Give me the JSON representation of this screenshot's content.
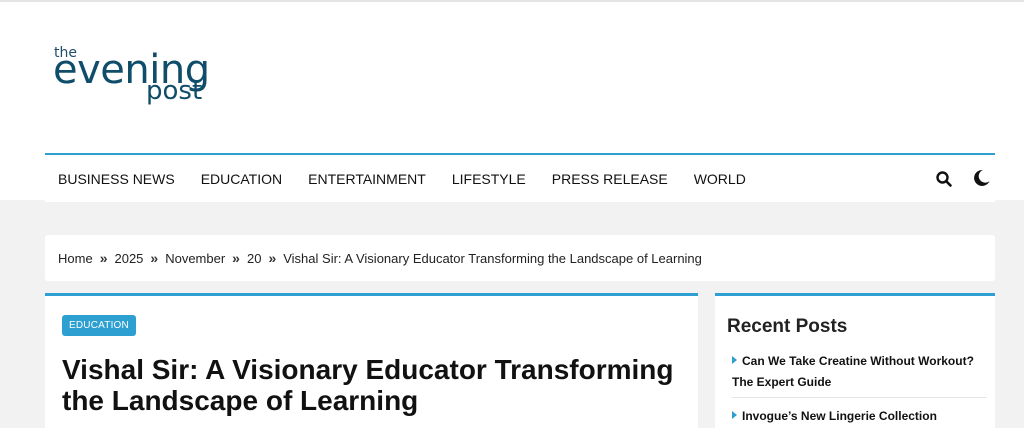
{
  "logo": {
    "the": "the",
    "evening": "evening",
    "post": "post"
  },
  "nav": {
    "items": [
      "BUSINESS NEWS",
      "EDUCATION",
      "ENTERTAINMENT",
      "LIFESTYLE",
      "PRESS RELEASE",
      "WORLD"
    ],
    "icons": [
      "search-icon",
      "moon-icon"
    ]
  },
  "breadcrumb": [
    "Home",
    "2025",
    "November",
    "20",
    "Vishal Sir: A Visionary Educator Transforming the Landscape of Learning"
  ],
  "breadcrumb_separator": "»",
  "article": {
    "category": "EDUCATION",
    "title": "Vishal Sir: A Visionary Educator Transforming the Landscape of Learning"
  },
  "sidebar": {
    "title": "Recent Posts",
    "posts": [
      "Can We Take Creatine Without Workout? The Expert Guide",
      "Invogue’s New Lingerie Collection"
    ]
  },
  "colors": {
    "accent": "#2d9fd0",
    "logo": "#0f4d6a",
    "background": "#f2f2f2"
  }
}
